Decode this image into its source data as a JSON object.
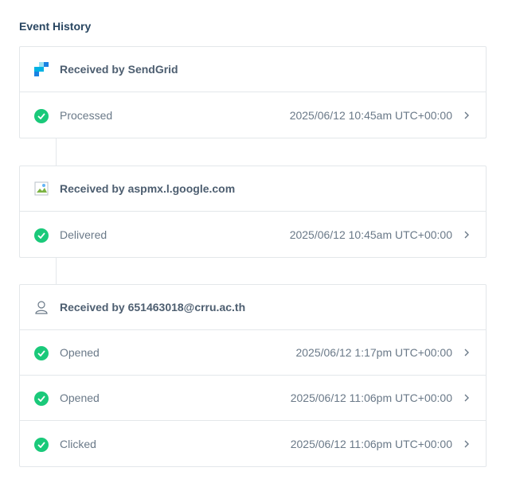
{
  "page": {
    "title": "Event History"
  },
  "groups": [
    {
      "header": "Received by SendGrid",
      "icon": "sendgrid-logo-icon",
      "events": [
        {
          "label": "Processed",
          "time": "2025/06/12 10:45am UTC+00:00"
        }
      ]
    },
    {
      "header": "Received by aspmx.l.google.com",
      "icon": "broken-image-icon",
      "events": [
        {
          "label": "Delivered",
          "time": "2025/06/12 10:45am UTC+00:00"
        }
      ]
    },
    {
      "header": "Received by 651463018@crru.ac.th",
      "icon": "user-icon",
      "events": [
        {
          "label": "Opened",
          "time": "2025/06/12 1:17pm UTC+00:00"
        },
        {
          "label": "Opened",
          "time": "2025/06/12 11:06pm UTC+00:00"
        },
        {
          "label": "Clicked",
          "time": "2025/06/12 11:06pm UTC+00:00"
        }
      ]
    }
  ],
  "colors": {
    "success": "#1ac97a",
    "border": "#e3e7ea",
    "heading": "#294661",
    "text": "#6a7988",
    "sendgrid_blue": "#1a82e2"
  }
}
